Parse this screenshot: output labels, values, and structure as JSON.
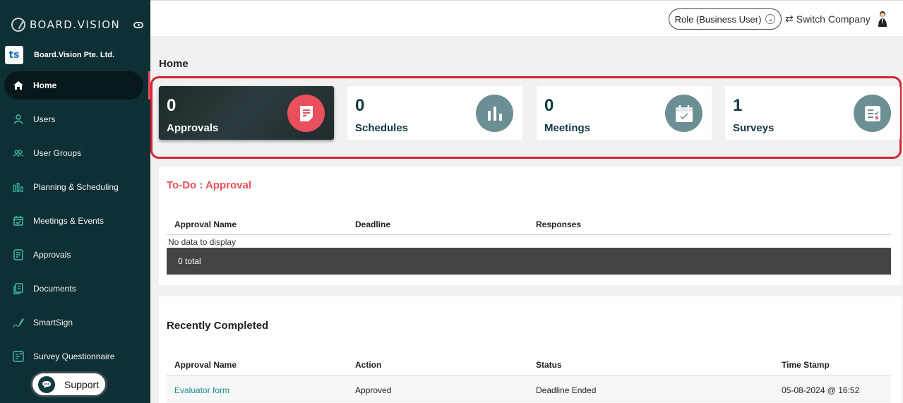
{
  "sidebar": {
    "brand": "BOARD.VISION",
    "company_name": "Board.Vision Pte. Ltd.",
    "company_logo_text": "ts",
    "items": [
      {
        "label": "Home",
        "icon": "home-icon",
        "active": true
      },
      {
        "label": "Users",
        "icon": "user-icon"
      },
      {
        "label": "User Groups",
        "icon": "user-group-icon"
      },
      {
        "label": "Planning & Scheduling",
        "icon": "bar-chart-icon"
      },
      {
        "label": "Meetings & Events",
        "icon": "calendar-icon"
      },
      {
        "label": "Approvals",
        "icon": "approval-doc-icon"
      },
      {
        "label": "Documents",
        "icon": "documents-icon"
      },
      {
        "label": "SmartSign",
        "icon": "pen-sign-icon"
      },
      {
        "label": "Survey Questionnaire",
        "icon": "survey-icon"
      }
    ],
    "support_label": "Support"
  },
  "topbar": {
    "role_label": "Role (Business User)",
    "switch_label": "Switch Company"
  },
  "page": {
    "title": "Home"
  },
  "stats": [
    {
      "count": "0",
      "label": "Approvals",
      "icon": "document-icon",
      "active": true
    },
    {
      "count": "0",
      "label": "Schedules",
      "icon": "bar-chart-icon"
    },
    {
      "count": "0",
      "label": "Meetings",
      "icon": "calendar-check-icon"
    },
    {
      "count": "1",
      "label": "Surveys",
      "icon": "checklist-icon"
    }
  ],
  "todo": {
    "title": "To-Do : Approval",
    "columns": [
      "Approval Name",
      "Deadline",
      "Responses"
    ],
    "empty_text": "No data to display",
    "total_text": "0 total"
  },
  "recent": {
    "title": "Recently Completed",
    "columns": [
      "Approval Name",
      "Action",
      "Status",
      "Time Stamp"
    ],
    "rows": [
      {
        "name": "Evaluator form",
        "action": "Approved",
        "status": "Deadline Ended",
        "timestamp": "05-08-2024 @ 16:52"
      }
    ]
  },
  "colors": {
    "sidebar_bg": "#0e2f33",
    "accent_red": "#e9505c",
    "icon_teal": "#6b8f93",
    "link": "#1d8a94"
  }
}
